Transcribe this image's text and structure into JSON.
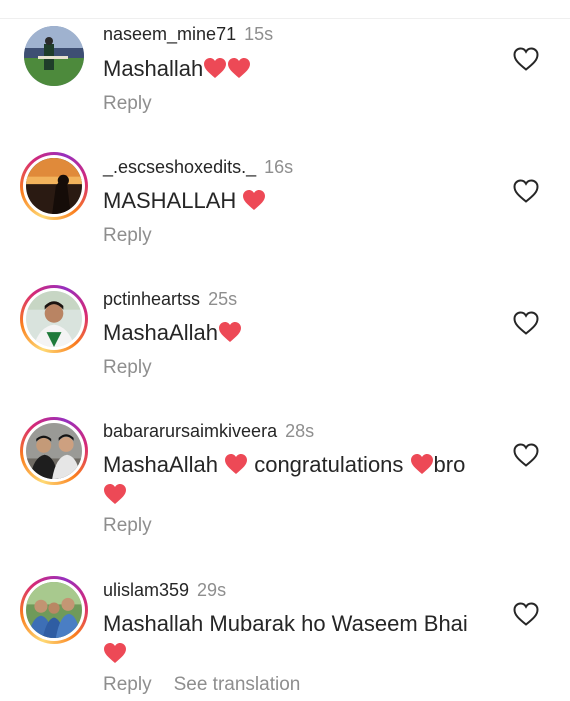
{
  "colors": {
    "text": "#262626",
    "muted": "#8e8e8e",
    "heart": "#ed4956"
  },
  "comments": [
    {
      "username": "naseem_mine71",
      "time": "15s",
      "text": "Mashallah",
      "emoji": "red-heart-x2",
      "reply_label": "Reply",
      "has_story": false
    },
    {
      "username": "_.escseshoxedits._",
      "time": "16s",
      "text": "MASHALLAH",
      "emoji": "red-heart",
      "reply_label": "Reply",
      "has_story": true
    },
    {
      "username": "pctinheartss",
      "time": "25s",
      "text": "MashaAllah",
      "emoji": "red-heart",
      "reply_label": "Reply",
      "has_story": true
    },
    {
      "username": "babararursaimkiveera",
      "time": "28s",
      "text_parts": [
        "MashaAllah",
        "congratulations",
        "bro"
      ],
      "reply_label": "Reply",
      "has_story": true
    },
    {
      "username": "ulislam359",
      "time": "29s",
      "text": "Mashallah Mubarak ho Waseem Bhai",
      "reply_label": "Reply",
      "see_translation_label": "See translation",
      "has_story": true
    }
  ]
}
